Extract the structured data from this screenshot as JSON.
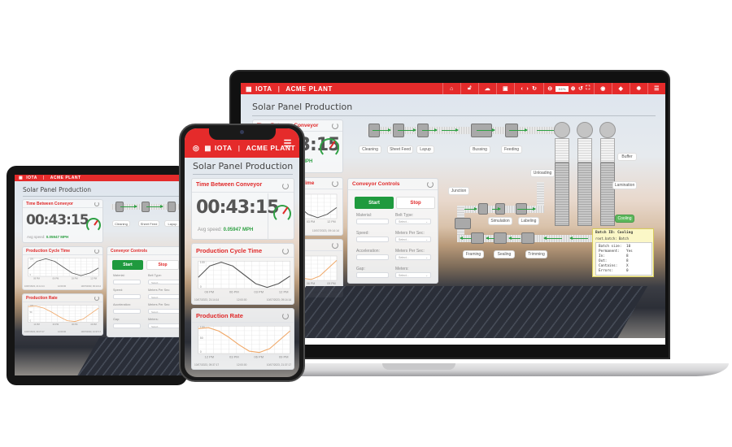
{
  "app": {
    "logo_brand": "IOTA",
    "logo_site": "ACME PLANT",
    "page_title": "Solar Panel Production",
    "header_color": "#e52b2b",
    "accent_green": "#2ea043"
  },
  "toolbar": {
    "icons": [
      "home-icon",
      "unlock-icon",
      "cloud-icon",
      "save-icon",
      "back-icon",
      "forward-icon",
      "reload-icon",
      "zoom-out-icon",
      "zoom-in-icon",
      "undo-icon",
      "fullscreen-icon",
      "layers-icon",
      "gem-icon",
      "settings-icon",
      "menu-icon"
    ],
    "zoom_value": "93%"
  },
  "time_card": {
    "title": "Time Between Conveyor",
    "time": "00:43:15",
    "avg_label": "Avg speed:",
    "avg_value": "0.05947 MPH",
    "gauge_fraction": 0.62
  },
  "cycle_card": {
    "title": "Production Cycle Time",
    "ts_start": "10/07/2023, 21:14:14",
    "ts_mid": "12:00:00",
    "ts_end": "10/07/2023, 09:14:14"
  },
  "rate_card": {
    "title": "Production Rate",
    "ts_start": "10/07/2023, 09:37:17",
    "ts_mid": "12:00:00",
    "ts_end": "10/07/2023, 21:37:17"
  },
  "controls": {
    "title": "Conveyor Controls",
    "start_label": "Start",
    "stop_label": "Stop",
    "fields": [
      {
        "label": "Material:",
        "select_label": "Belt Type:"
      },
      {
        "label": "Speed:",
        "select_label": "Meters Per Sec:"
      },
      {
        "label": "Acceleration:",
        "select_label": "Meters Per Sec:"
      },
      {
        "label": "Gap:",
        "select_label": "Meters:"
      }
    ],
    "select_placeholder": "Select..."
  },
  "stations": {
    "cleaning": "Cleaning",
    "sheet_feed": "Sheet Feed",
    "layup": "Layup",
    "bussing": "Bussing",
    "feeding": "Feeding",
    "buffer": "Buffer",
    "unloading": "Unloading",
    "lamination": "Lamination",
    "junction": "Junction",
    "simulation": "Simulation",
    "labeling": "Labeling",
    "cooling": "Cooling",
    "framing": "Framing",
    "sealing": "Sealing",
    "trimming": "Trimming"
  },
  "tooltip": {
    "title": "Batch ID: Cooling",
    "subtitle": "root.batch: Batch",
    "rows": [
      {
        "k": "Batch size:",
        "v": "10"
      },
      {
        "k": "Permanent:",
        "v": "Yes"
      },
      {
        "k": "In:",
        "v": "8"
      },
      {
        "k": "Out:",
        "v": "8"
      },
      {
        "k": "Contains:",
        "v": "X"
      },
      {
        "k": "Errors:",
        "v": "0"
      }
    ]
  },
  "chart_data": [
    {
      "type": "line",
      "title": "Production Cycle Time",
      "x": [
        "09 PM",
        "06 PM",
        "03 PM",
        "12 PM"
      ],
      "ylim": [
        0,
        100
      ],
      "yticks": [
        "0",
        "100"
      ],
      "series": [
        {
          "name": "cycle",
          "color": "#555555",
          "values": [
            40,
            85,
            100,
            85,
            50,
            15,
            0,
            15,
            45
          ]
        }
      ]
    },
    {
      "type": "line",
      "title": "Production Rate",
      "x": [
        "12 PM",
        "03 PM",
        "06 PM",
        "09 PM"
      ],
      "ylim": [
        0,
        100
      ],
      "yticks": [
        "0",
        "50",
        "100"
      ],
      "series": [
        {
          "name": "rate",
          "color": "#f0a868",
          "values": [
            95,
            98,
            85,
            60,
            30,
            5,
            0,
            15,
            50,
            85
          ]
        }
      ]
    }
  ]
}
